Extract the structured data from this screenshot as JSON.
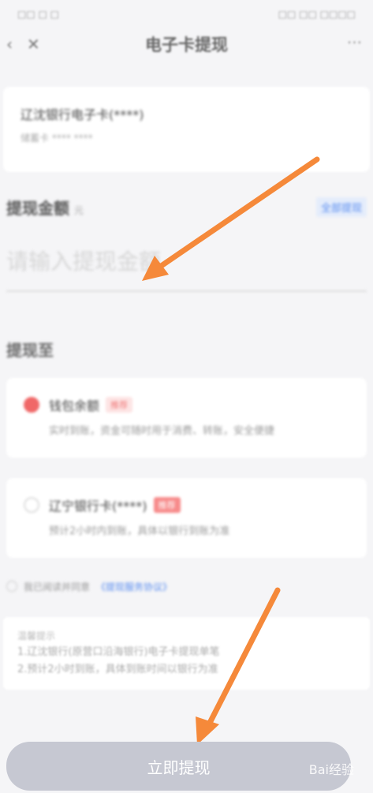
{
  "status": {
    "left": "□□ □ □",
    "right": "□□ □□ □□□□"
  },
  "nav": {
    "back": "‹",
    "close": "✕",
    "title": "电子卡提现",
    "more": "···"
  },
  "card": {
    "title": "辽沈银行电子卡(****)",
    "sub": "储蓄卡 **** ****"
  },
  "amount": {
    "label": "提现金额",
    "hint": "元",
    "all": "全部提现",
    "placeholder": "请输入提现金额"
  },
  "to": {
    "label": "提现至",
    "options": [
      {
        "title": "钱包余额",
        "tag": "推荐",
        "desc": "实时到账，资金可随时用于消费、转账，安全便捷"
      },
      {
        "title": "辽宁银行卡(****)",
        "tag": "推荐",
        "desc": "预计2小时内到账，具体以银行到账为准"
      }
    ]
  },
  "agree": {
    "text": "我已阅读并同意",
    "link": "《提现服务协议》"
  },
  "notice": {
    "title": "温馨提示",
    "lines": [
      "1.辽沈银行(原营口沿海银行)电子卡提现单笔",
      "2.预计2小时到账，具体到账时间以银行为准"
    ]
  },
  "submit": "立即提现",
  "watermark": "Bai经验"
}
